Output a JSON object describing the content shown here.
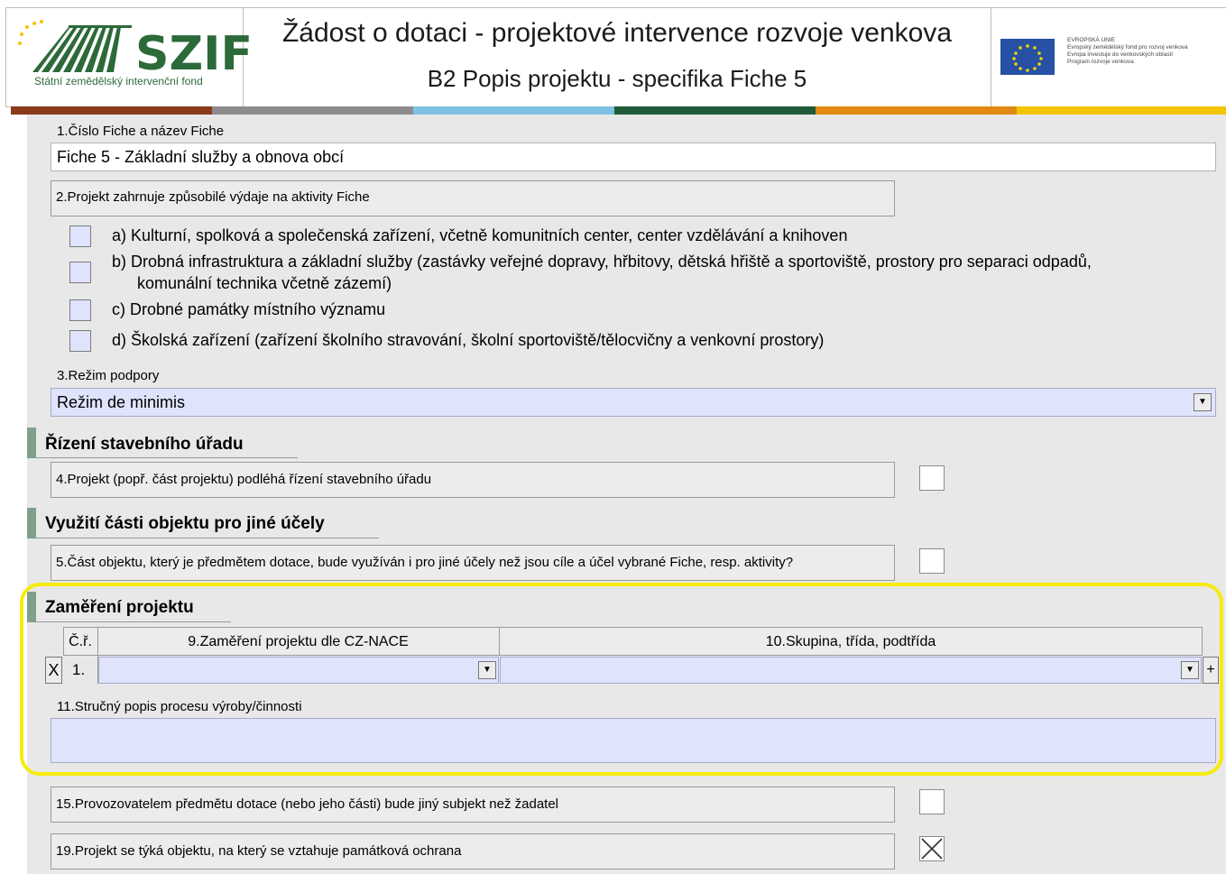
{
  "header": {
    "logo_name": "SZIF",
    "logo_subtitle": "Státní zemědělský intervenční fond",
    "title": "Žádost o dotaci - projektové intervence rozvoje venkova",
    "subtitle": "B2 Popis projektu - specifika Fiche 5",
    "eu_lines": [
      "EVROPSKÁ UNIE",
      "Evropský zemědělský fond pro rozvoj venkova",
      "Evropa investuje do venkovských oblastí",
      "Program rozvoje venkova"
    ],
    "strip_colors": [
      "#8a3a1a",
      "#8c8c8c",
      "#7ec0e2",
      "#1f5a3a",
      "#e08a10",
      "#f2c400"
    ]
  },
  "form": {
    "q1_label": "1.Číslo Fiche a název Fiche",
    "q1_value": "Fiche 5 - Základní služby a obnova obcí",
    "q2_label": "2.Projekt zahrnuje způsobilé výdaje na aktivity Fiche",
    "q2_options": [
      {
        "text": "a) Kulturní, spolková a společenská zařízení, včetně komunitních center, center vzdělávání a knihoven",
        "checked": false
      },
      {
        "text": "b) Drobná infrastruktura a základní služby (zastávky veřejné dopravy, hřbitovy, dětská hřiště a sportoviště, prostory pro separaci odpadů,",
        "text2": "komunální technika včetně zázemí)",
        "checked": false
      },
      {
        "text": "c) Drobné památky místního významu",
        "checked": false
      },
      {
        "text": "d) Školská zařízení (zařízení školního stravování, školní sportoviště/tělocvičny a venkovní prostory)",
        "checked": false
      }
    ],
    "q3_label": "3.Režim podpory",
    "q3_value": "Režim de minimis",
    "section_building": "Řízení stavebního úřadu",
    "q4_label": "4.Projekt (popř. část projektu) podléhá řízení stavebního úřadu",
    "q4_checked": false,
    "section_other_use": "Využití části objektu pro jiné účely",
    "q5_label": "5.Část objektu, který je předmětem dotace, bude využíván i pro jiné účely než jsou cíle a účel vybrané Fiche, resp. aktivity?",
    "q5_checked": false,
    "section_focus": "Zaměření projektu",
    "table": {
      "col_num": "Č.ř.",
      "col_9": "9.Zaměření projektu dle CZ-NACE",
      "col_10": "10.Skupina, třída, podtřída",
      "row_num": "1.",
      "remove_btn": "X",
      "add_btn": "+",
      "row_9_value": "",
      "row_10_value": ""
    },
    "q11_label": "11.Stručný popis procesu výroby/činnosti",
    "q11_value": "",
    "q15_label": "15.Provozovatelem předmětu dotace (nebo jeho části) bude jiný subjekt než žadatel",
    "q15_checked": false,
    "q19_label": "19.Projekt se týká objektu, na který se vztahuje památková ochrana",
    "q19_checked": true,
    "dropdown_icon": "triangle-down-icon",
    "highlight_color": "#f6eb0d"
  }
}
